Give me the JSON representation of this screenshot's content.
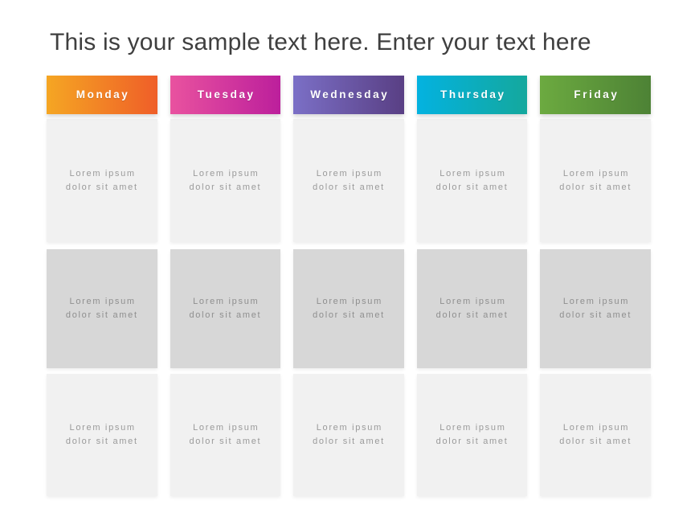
{
  "slide": {
    "title": "This is your sample text here. Enter your text here",
    "background_color": "#ffffff",
    "title_color": "#3f3f3f"
  },
  "table": {
    "columns": [
      {
        "id": "monday",
        "header": "Monday",
        "gradient_from": "#f5a623",
        "gradient_to": "#ef5e28",
        "cells": [
          {
            "text": "Lorem ipsum dolor sit amet",
            "background_color": "#f1f1f1"
          },
          {
            "text": "Lorem ipsum dolor sit amet",
            "background_color": "#d7d7d7"
          },
          {
            "text": "Lorem ipsum dolor sit amet",
            "background_color": "#f1f1f1"
          }
        ]
      },
      {
        "id": "tuesday",
        "header": "Tuesday",
        "gradient_from": "#e9529f",
        "gradient_to": "#bc1f9c",
        "cells": [
          {
            "text": "Lorem ipsum dolor sit amet",
            "background_color": "#f1f1f1"
          },
          {
            "text": "Lorem ipsum dolor sit amet",
            "background_color": "#d7d7d7"
          },
          {
            "text": "Lorem ipsum dolor sit amet",
            "background_color": "#f1f1f1"
          }
        ]
      },
      {
        "id": "wednesday",
        "header": "Wednesday",
        "gradient_from": "#7b6fc6",
        "gradient_to": "#593f84",
        "cells": [
          {
            "text": "Lorem ipsum dolor sit amet",
            "background_color": "#f1f1f1"
          },
          {
            "text": "Lorem ipsum dolor sit amet",
            "background_color": "#d7d7d7"
          },
          {
            "text": "Lorem ipsum dolor sit amet",
            "background_color": "#f1f1f1"
          }
        ]
      },
      {
        "id": "thursday",
        "header": "Thursday",
        "gradient_from": "#03b2e0",
        "gradient_to": "#14a89d",
        "cells": [
          {
            "text": "Lorem ipsum dolor sit amet",
            "background_color": "#f1f1f1"
          },
          {
            "text": "Lorem ipsum dolor sit amet",
            "background_color": "#d7d7d7"
          },
          {
            "text": "Lorem ipsum dolor sit amet",
            "background_color": "#f1f1f1"
          }
        ]
      },
      {
        "id": "friday",
        "header": "Friday",
        "gradient_from": "#6caa40",
        "gradient_to": "#4d8235",
        "cells": [
          {
            "text": "Lorem ipsum dolor sit amet",
            "background_color": "#f1f1f1"
          },
          {
            "text": "Lorem ipsum dolor sit amet",
            "background_color": "#d7d7d7"
          },
          {
            "text": "Lorem ipsum dolor sit amet",
            "background_color": "#f1f1f1"
          }
        ]
      }
    ]
  }
}
